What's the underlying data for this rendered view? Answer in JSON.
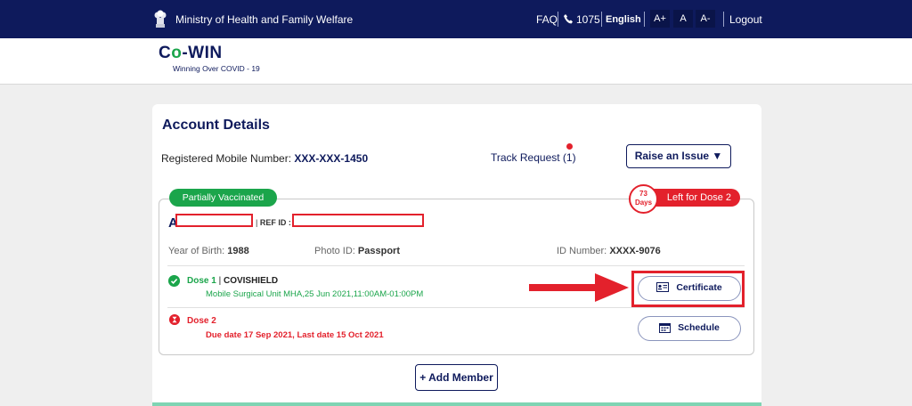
{
  "topbar": {
    "ministry": "Ministry of Health and Family Welfare",
    "faq": "FAQ",
    "helpline": "1075",
    "language": "English",
    "font_increase": "A+",
    "font_normal": "A",
    "font_decrease": "A-",
    "logout": "Logout"
  },
  "logo": {
    "pre": "C",
    "o": "o",
    "post": "-WIN",
    "tagline": "Winning Over COVID - 19"
  },
  "account": {
    "title": "Account Details",
    "reg_mobile_label": "Registered Mobile Number:",
    "reg_mobile_value": "XXX-XXX-1450",
    "track_request": "Track Request (1)",
    "raise_issue": "Raise an Issue ▼"
  },
  "member": {
    "status_badge": "Partially Vaccinated",
    "days_value": "73",
    "days_unit": "Days",
    "left_for": "Left for Dose 2",
    "name_initial": "A",
    "ref_sep": "|",
    "ref_label": "REF ID :",
    "yob_label": "Year of Birth:",
    "yob_value": "1988",
    "photo_id_label": "Photo ID:",
    "photo_id_value": "Passport",
    "id_number_label": "ID Number:",
    "id_number_value": "XXXX-9076",
    "dose1_label": "Dose 1",
    "dose1_sep": "|",
    "dose1_vaccine": "COVISHIELD",
    "dose1_detail": "Mobile Surgical Unit MHA,25 Jun 2021,11:00AM-01:00PM",
    "dose2_label": "Dose 2",
    "dose2_detail": "Due date 17 Sep 2021, Last date  15 Oct 2021",
    "certificate_button": "Certificate",
    "schedule_button": "Schedule"
  },
  "add_member": "+ Add Member",
  "colors": {
    "navy": "#0e1a5c",
    "green": "#1ba54b",
    "red": "#e3212c"
  },
  "icons": [
    "emblem-icon",
    "phone-icon",
    "check-circle-icon",
    "hourglass-icon",
    "certificate-icon",
    "calendar-icon",
    "red-arrow-icon"
  ]
}
